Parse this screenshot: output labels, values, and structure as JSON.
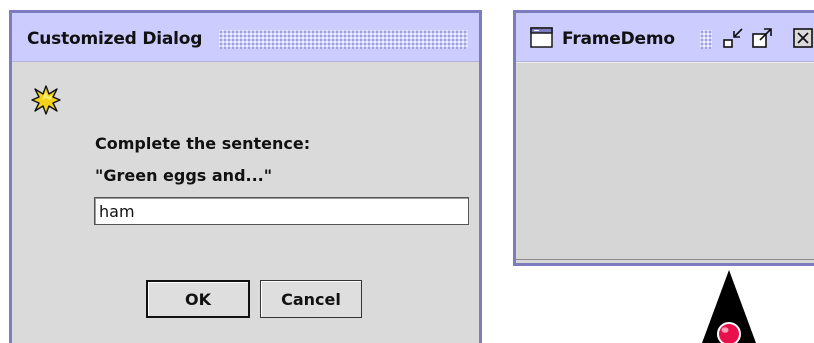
{
  "dialog": {
    "title": "Customized Dialog",
    "prompt_line_1": "Complete the sentence:",
    "prompt_line_2": "\"Green eggs and...\"",
    "answer_value": "ham",
    "ok_label": "OK",
    "cancel_label": "Cancel",
    "icon": "star-burst-icon"
  },
  "frame": {
    "title": "FrameDemo",
    "icon": "window-icon",
    "controls": [
      "minimize-icon",
      "maximize-icon",
      "close-icon"
    ]
  },
  "mascot": {
    "icon": "duke-mascot-icon"
  },
  "colors": {
    "titlebar": "#ccccff",
    "border": "#7d7dbd",
    "panel": "#dadada",
    "field": "#ffffff"
  }
}
